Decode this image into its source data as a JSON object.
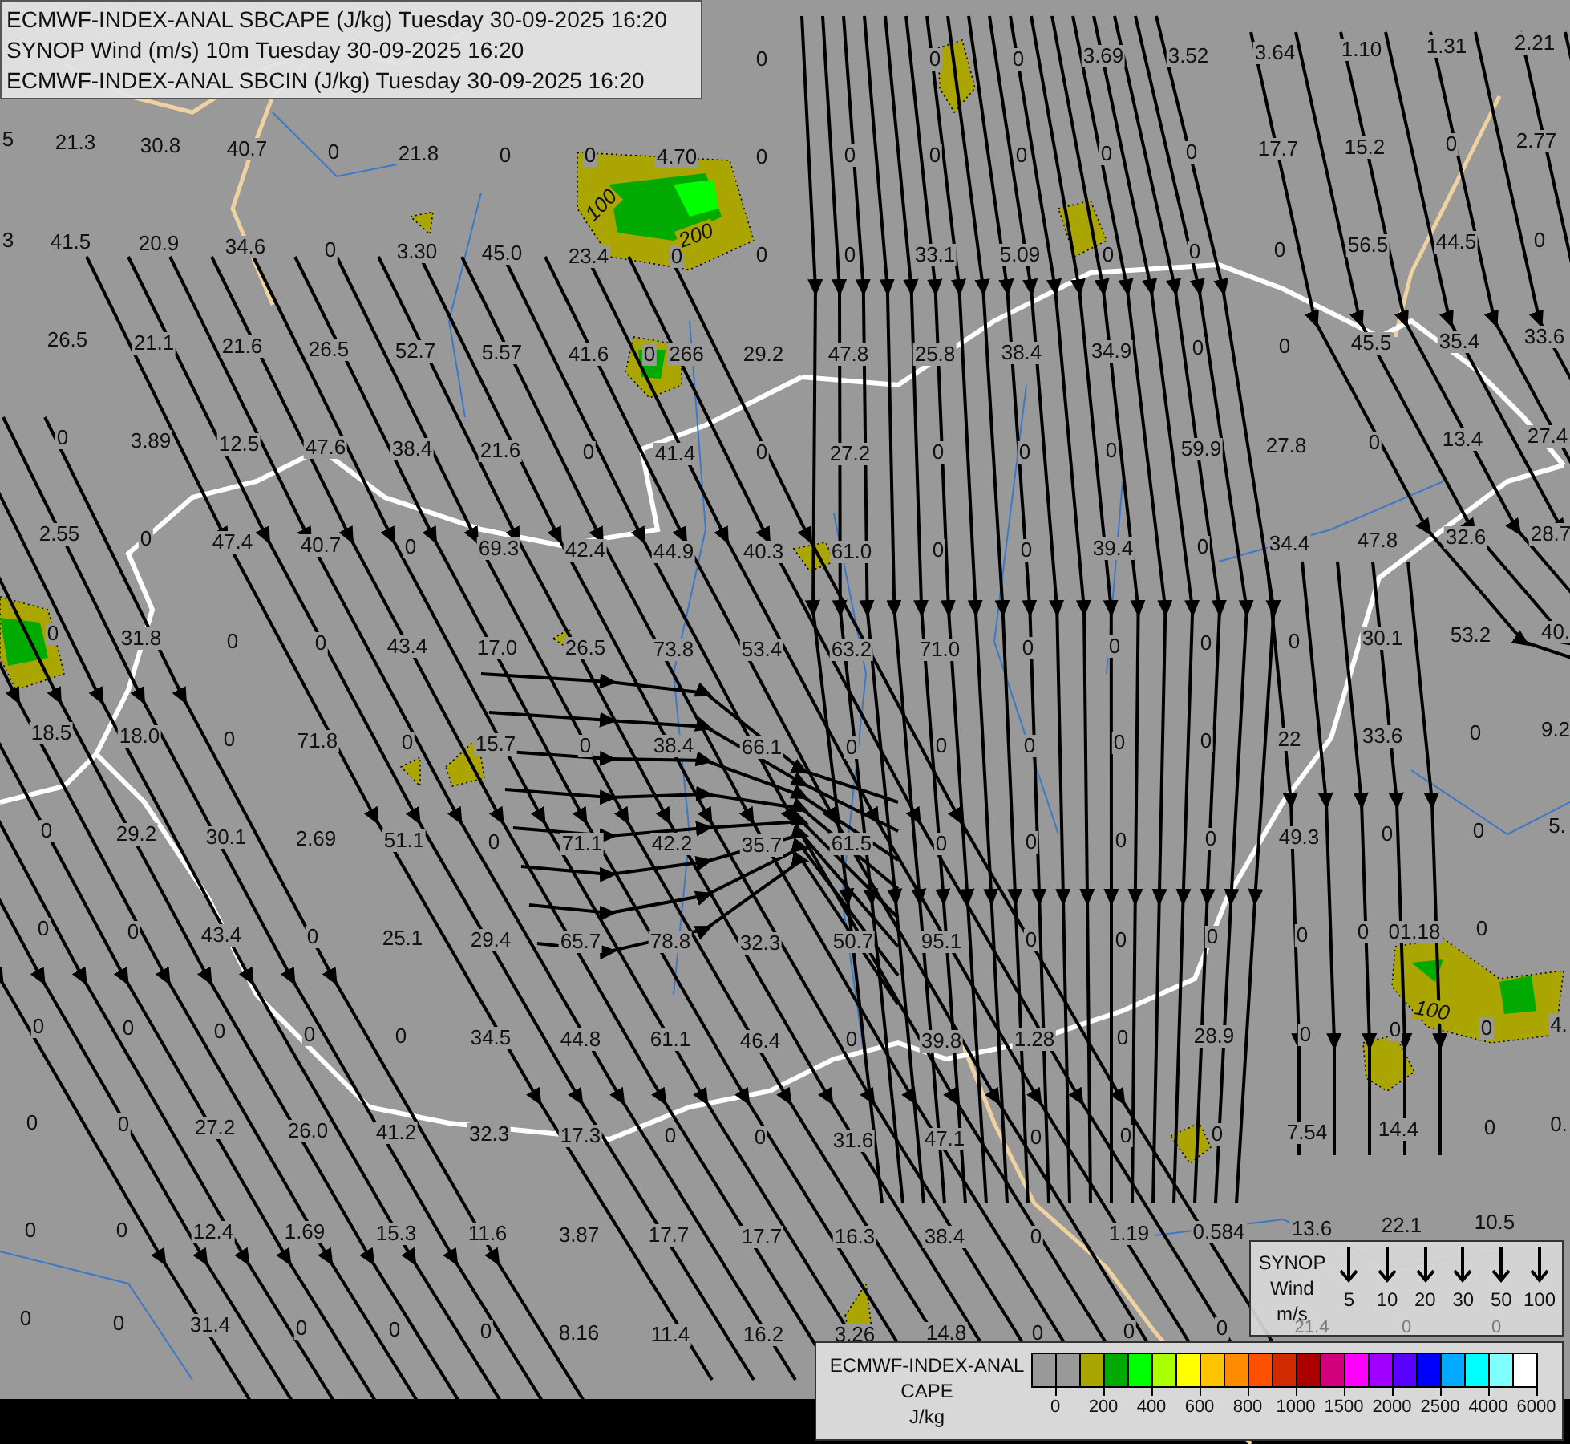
{
  "header": {
    "lines": [
      "ECMWF-INDEX-ANAL SBCAPE (J/kg) Tuesday 30-09-2025 16:20",
      "SYNOP Wind (m/s) 10m Tuesday 30-09-2025 16:20",
      "ECMWF-INDEX-ANAL SBCIN (J/kg) Tuesday 30-09-2025 16:20"
    ]
  },
  "map_values": [
    "0",
    "0",
    "0",
    "3.69",
    "3.52",
    "3.64",
    "1.10",
    "1.31",
    "2.21",
    "5",
    "21.3",
    "30.8",
    "40.7",
    "0",
    "21.8",
    "0",
    "0",
    "4.70",
    "0",
    "0",
    "0",
    "0",
    "0",
    "0",
    "17.7",
    "15.2",
    "0",
    "2.77",
    "3",
    "41.5",
    "20.9",
    "34.6",
    "0",
    "3.30",
    "45.0",
    "23.4",
    "0",
    "0",
    "0",
    "33.1",
    "5.09",
    "0",
    "0",
    "0",
    "56.5",
    "44.5",
    "0",
    "26.5",
    "21.1",
    "21.6",
    "26.5",
    "52.7",
    "5.57",
    "41.6",
    "0",
    "266",
    "29.2",
    "47.8",
    "25.8",
    "38.4",
    "34.9",
    "0",
    "0",
    "45.5",
    "35.4",
    "33.6",
    "0",
    "3.89",
    "12.5",
    "47.6",
    "38.4",
    "21.6",
    "0",
    "41.4",
    "0",
    "27.2",
    "0",
    "0",
    "0",
    "59.9",
    "27.8",
    "0",
    "13.4",
    "27.4",
    "2.55",
    "0",
    "47.4",
    "40.7",
    "0",
    "69.3",
    "42.4",
    "44.9",
    "40.3",
    "61.0",
    "0",
    "0",
    "39.4",
    "0",
    "34.4",
    "47.8",
    "32.6",
    "28.7",
    "0",
    "31.8",
    "0",
    "0",
    "43.4",
    "17.0",
    "26.5",
    "73.8",
    "53.4",
    "63.2",
    "71.0",
    "0",
    "0",
    "0",
    "0",
    "30.1",
    "53.2",
    "40.",
    "18.5",
    "18.0",
    "0",
    "71.8",
    "0",
    "15.7",
    "0",
    "38.4",
    "66.1",
    "0",
    "0",
    "0",
    "0",
    "0",
    "22",
    "33.6",
    "0",
    "9.2",
    "0",
    "29.2",
    "30.1",
    "2.69",
    "51.1",
    "0",
    "71.1",
    "42.2",
    "35.7",
    "61.5",
    "0",
    "0",
    "0",
    "0",
    "49.3",
    "0",
    "0",
    "5.",
    "0",
    "0",
    "43.4",
    "0",
    "25.1",
    "29.4",
    "65.7",
    "78.8",
    "32.3",
    "50.7",
    "95.1",
    "0",
    "0",
    "0",
    "0",
    "0",
    "01.18",
    "0",
    "0",
    "0",
    "0",
    "0",
    "0",
    "34.5",
    "44.8",
    "61.1",
    "46.4",
    "0",
    "39.8",
    "1.28",
    "0",
    "28.9",
    "0",
    "0",
    "0",
    "4.",
    "0",
    "0",
    "27.2",
    "26.0",
    "41.2",
    "32.3",
    "17.3",
    "0",
    "0",
    "31.6",
    "47.1",
    "0",
    "0",
    "0",
    "7.54",
    "14.4",
    "0",
    "0.",
    "0",
    "0",
    "12.4",
    "1.69",
    "15.3",
    "11.6",
    "3.87",
    "17.7",
    "17.7",
    "16.3",
    "38.4",
    "0",
    "1.19",
    "0.584",
    "13.6",
    "22.1",
    "10.5",
    "0",
    "0",
    "31.4",
    "0",
    "0",
    "0",
    "8.16",
    "11.4",
    "16.2",
    "3.26",
    "14.8",
    "0",
    "0",
    "0"
  ],
  "faint_values": [
    "21.4",
    "0",
    "0"
  ],
  "contour_labels": [
    "100",
    "200",
    "100"
  ],
  "wind_legend": {
    "title_lines": [
      "SYNOP",
      "Wind",
      "m/s"
    ],
    "speeds": [
      "5",
      "10",
      "20",
      "30",
      "50",
      "100"
    ]
  },
  "cape_legend": {
    "title_lines": [
      "ECMWF-INDEX-ANAL",
      "CAPE"
    ],
    "unit": "J/kg",
    "colors": [
      {
        "color": "#999999"
      },
      {
        "color": "#999999"
      },
      {
        "color": "#aaa500"
      },
      {
        "color": "#00aa00"
      },
      {
        "color": "#00ff00"
      },
      {
        "color": "#aaff00"
      },
      {
        "color": "#ffff00"
      },
      {
        "color": "#ffc400"
      },
      {
        "color": "#ff8c00"
      },
      {
        "color": "#ff5000"
      },
      {
        "color": "#d22a00"
      },
      {
        "color": "#aa0000"
      },
      {
        "color": "#d2007a"
      },
      {
        "color": "#ff00ff"
      },
      {
        "color": "#a000ff"
      },
      {
        "color": "#5a00ff"
      },
      {
        "color": "#0000ff"
      },
      {
        "color": "#00aaff"
      },
      {
        "color": "#00ffff"
      },
      {
        "color": "#80ffff"
      },
      {
        "color": "#ffffff"
      }
    ],
    "ticks": [
      "0",
      "200",
      "400",
      "600",
      "800",
      "1000",
      "1500",
      "2000",
      "2500",
      "4000",
      "6000"
    ]
  }
}
